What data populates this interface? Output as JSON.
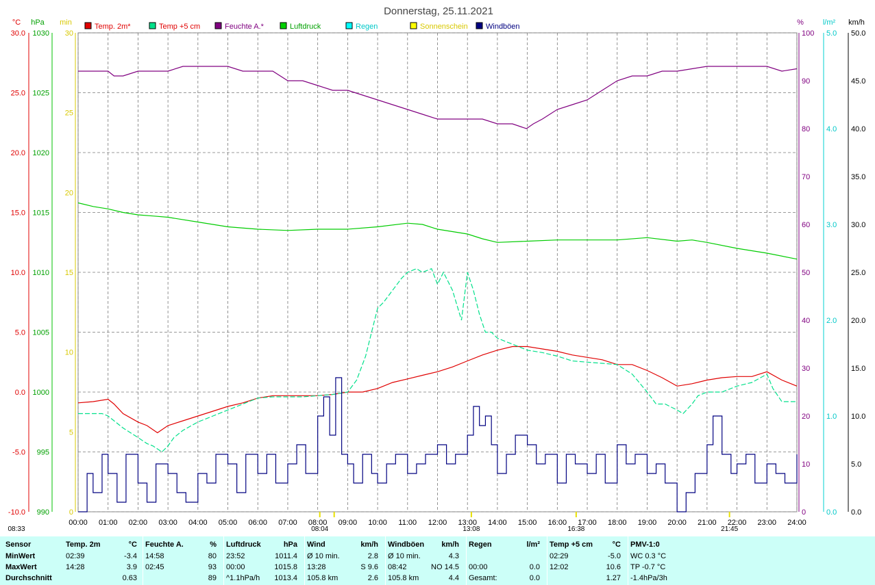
{
  "title": "Donnerstag, 25.11.2021",
  "legend": [
    {
      "label": "Temp. 2m*",
      "color": "#e00000",
      "text_color": "#e00000"
    },
    {
      "label": "Temp +5 cm",
      "color": "#00e08a",
      "text_color": "#e00000"
    },
    {
      "label": "Feuchte A.*",
      "color": "#800080",
      "text_color": "#800080"
    },
    {
      "label": "Luftdruck",
      "color": "#00d000",
      "text_color": "#00a000"
    },
    {
      "label": "Regen",
      "color": "#00ffff",
      "text_color": "#00c8c8"
    },
    {
      "label": "Sonnenschein",
      "color": "#ffff00",
      "text_color": "#d8c800"
    },
    {
      "label": "Windböen",
      "color": "#000080",
      "text_color": "#000080"
    }
  ],
  "colors": {
    "temp": "#e00000",
    "temp5": "#00e08a",
    "hum": "#800080",
    "press": "#00cc00",
    "rain": "#00d0d0",
    "sun": "#e8e000",
    "wind": "#000080",
    "grid": "#888888"
  },
  "chart_data": {
    "type": "line",
    "x_ticks": [
      "00:00",
      "01:00",
      "02:00",
      "03:00",
      "04:00",
      "05:00",
      "06:00",
      "07:00",
      "08:00",
      "09:00",
      "10:00",
      "11:00",
      "12:00",
      "13:00",
      "14:00",
      "15:00",
      "16:00",
      "17:00",
      "18:00",
      "19:00",
      "20:00",
      "21:00",
      "22:00",
      "23:00",
      "24:00"
    ],
    "xlim": [
      0,
      24
    ],
    "axes": {
      "temp": {
        "unit": "°C",
        "ticks": [
          "30.0",
          "25.0",
          "20.0",
          "15.0",
          "10.0",
          "5.0",
          "0.0",
          "-5.0",
          "-10.0"
        ],
        "ylim": [
          -10,
          30
        ]
      },
      "press": {
        "unit": "hPa",
        "ticks": [
          "1030",
          "1025",
          "1020",
          "1015",
          "1010",
          "1005",
          "1000",
          "995",
          "990"
        ],
        "ylim": [
          990,
          1030
        ]
      },
      "sun": {
        "unit": "min",
        "ticks": [
          "30",
          "25",
          "20",
          "15",
          "10",
          "5",
          "0"
        ],
        "ylim": [
          0,
          30
        ]
      },
      "hum": {
        "unit": "%",
        "ticks": [
          "100",
          "90",
          "80",
          "70",
          "60",
          "50",
          "40",
          "30",
          "20",
          "10",
          "0"
        ],
        "ylim": [
          0,
          100
        ]
      },
      "rain": {
        "unit": "l/m²",
        "ticks": [
          "5.0",
          "4.0",
          "3.0",
          "2.0",
          "1.0",
          "0.0"
        ],
        "ylim": [
          0,
          5
        ]
      },
      "wind": {
        "unit": "km/h",
        "ticks": [
          "50.0",
          "45.0",
          "40.0",
          "35.0",
          "30.0",
          "25.0",
          "20.0",
          "15.0",
          "10.0",
          "5.0",
          "0.0"
        ],
        "ylim": [
          0,
          50
        ]
      }
    },
    "series": [
      {
        "name": "Temp. 2m*",
        "axis": "temp",
        "x": [
          0,
          0.5,
          1,
          1.2,
          1.5,
          2,
          2.3,
          2.65,
          3,
          3.5,
          4,
          4.5,
          5,
          5.5,
          6,
          6.5,
          7,
          7.5,
          8,
          8.5,
          9,
          9.5,
          10,
          10.5,
          11,
          11.5,
          12,
          12.5,
          13,
          13.5,
          14,
          14.5,
          15,
          15.5,
          16,
          16.5,
          17,
          17.5,
          18,
          18.5,
          19,
          19.5,
          20,
          20.5,
          21,
          21.5,
          22,
          22.5,
          23,
          23.5,
          24
        ],
        "y": [
          -0.9,
          -0.8,
          -0.6,
          -1.0,
          -1.8,
          -2.5,
          -2.8,
          -3.4,
          -2.8,
          -2.4,
          -2.0,
          -1.6,
          -1.2,
          -0.9,
          -0.5,
          -0.3,
          -0.3,
          -0.3,
          -0.3,
          -0.2,
          0.0,
          0.0,
          0.3,
          0.8,
          1.1,
          1.4,
          1.7,
          2.1,
          2.6,
          3.1,
          3.5,
          3.8,
          3.8,
          3.6,
          3.4,
          3.1,
          2.9,
          2.7,
          2.3,
          2.3,
          1.8,
          1.2,
          0.5,
          0.7,
          1.0,
          1.2,
          1.3,
          1.3,
          1.7,
          1.0,
          0.5
        ]
      },
      {
        "name": "Feuchte A.*",
        "axis": "hum",
        "x": [
          0,
          1,
          1.2,
          1.5,
          2,
          3,
          3.5,
          4,
          4.5,
          5,
          5.5,
          6,
          6.5,
          7,
          7.5,
          8,
          8.5,
          9,
          9.5,
          10,
          10.5,
          11,
          11.5,
          12,
          12.5,
          13,
          13.5,
          14,
          14.5,
          14.97,
          15.2,
          15.5,
          16,
          16.5,
          17,
          17.5,
          18,
          18.5,
          19,
          19.5,
          20,
          20.5,
          21,
          21.5,
          22,
          22.5,
          23,
          23.5,
          24
        ],
        "y": [
          92,
          92,
          91,
          91,
          92,
          92,
          93,
          93,
          93,
          93,
          92,
          92,
          92,
          90,
          90,
          89,
          88,
          88,
          87,
          86,
          85,
          84,
          83,
          82,
          82,
          82,
          82,
          81,
          81,
          80,
          81,
          82,
          84,
          85,
          86,
          88,
          90,
          91,
          91,
          92,
          92,
          92.5,
          93,
          93,
          93,
          93,
          93,
          92,
          92.5
        ]
      },
      {
        "name": "Luftdruck",
        "axis": "press",
        "x": [
          0,
          0.5,
          1,
          1.5,
          2,
          2.5,
          3,
          4,
          5,
          6,
          7,
          8,
          9,
          10,
          11,
          11.5,
          12,
          13,
          13.5,
          14,
          15,
          16,
          17,
          18,
          19,
          20,
          20.5,
          21,
          22,
          23,
          24
        ],
        "y": [
          1015.8,
          1015.5,
          1015.3,
          1015.0,
          1014.8,
          1014.7,
          1014.6,
          1014.2,
          1013.8,
          1013.6,
          1013.5,
          1013.6,
          1013.6,
          1013.8,
          1014.1,
          1014.0,
          1013.6,
          1013.2,
          1012.8,
          1012.5,
          1012.6,
          1012.7,
          1012.7,
          1012.7,
          1012.9,
          1012.6,
          1012.7,
          1012.5,
          1012.0,
          1011.6,
          1011.1
        ]
      },
      {
        "name": "Temp +5 cm",
        "axis": "temp",
        "x": [
          0,
          0.8,
          1,
          1.5,
          2,
          2.3,
          2.5,
          2.8,
          3,
          3.2,
          3.5,
          4,
          4.5,
          5,
          5.5,
          6,
          6.5,
          7,
          7.5,
          8,
          8.5,
          9,
          9.3,
          9.6,
          9.8,
          10,
          10.2,
          10.5,
          10.8,
          11,
          11.3,
          11.5,
          11.8,
          12,
          12.2,
          12.5,
          12.8,
          13,
          13.2,
          13.4,
          13.6,
          13.8,
          14,
          14.5,
          15,
          15.5,
          16,
          16.5,
          17,
          17.5,
          18,
          18.5,
          19,
          19.3,
          19.6,
          20,
          20.2,
          20.5,
          20.7,
          21,
          21.5,
          22,
          22.5,
          23,
          23.2,
          23.5,
          24
        ],
        "y": [
          -1.8,
          -1.8,
          -2.0,
          -3.0,
          -3.8,
          -4.3,
          -4.5,
          -5.0,
          -4.5,
          -3.8,
          -3.2,
          -2.5,
          -2.0,
          -1.5,
          -1.0,
          -0.5,
          -0.4,
          -0.4,
          -0.4,
          -0.3,
          -0.2,
          0.0,
          1.0,
          3.0,
          5.0,
          7.0,
          7.5,
          8.5,
          9.5,
          10.0,
          10.3,
          10.0,
          10.3,
          9.0,
          10.0,
          8.5,
          6.0,
          10.0,
          8.5,
          6.5,
          5.0,
          5.0,
          4.5,
          4.0,
          3.5,
          3.3,
          3.0,
          2.6,
          2.5,
          2.4,
          2.3,
          1.5,
          0.0,
          -1.0,
          -1.0,
          -1.5,
          -1.8,
          -1.0,
          -0.3,
          0.0,
          0.0,
          0.5,
          0.8,
          1.5,
          0.3,
          -0.8,
          -0.8
        ]
      },
      {
        "name": "Windböen",
        "axis": "wind",
        "x": [
          0,
          0.3,
          0.5,
          0.8,
          1,
          1.3,
          1.6,
          2,
          2.3,
          2.6,
          3,
          3.3,
          3.6,
          4,
          4.3,
          4.6,
          5,
          5.3,
          5.6,
          6,
          6.3,
          6.6,
          7,
          7.3,
          7.6,
          8,
          8.2,
          8.4,
          8.6,
          8.8,
          9,
          9.2,
          9.5,
          9.8,
          10,
          10.3,
          10.6,
          11,
          11.3,
          11.6,
          12,
          12.3,
          12.6,
          13,
          13.2,
          13.4,
          13.6,
          13.8,
          14,
          14.3,
          14.6,
          15,
          15.3,
          15.6,
          16,
          16.3,
          16.6,
          17,
          17.3,
          17.6,
          18,
          18.3,
          18.6,
          19,
          19.3,
          19.6,
          20,
          20.3,
          20.6,
          21,
          21.2,
          21.5,
          21.8,
          22,
          22.3,
          22.6,
          23,
          23.3,
          23.6,
          24
        ],
        "y": [
          0,
          4,
          2,
          6,
          4,
          1,
          6,
          3,
          1,
          5,
          4,
          2,
          1,
          4,
          3,
          6,
          5,
          2,
          6,
          4,
          6,
          3,
          5,
          7,
          4,
          10,
          12,
          8,
          14,
          6,
          5,
          3,
          6,
          4,
          3,
          5,
          6,
          4,
          5,
          6,
          7,
          5,
          6,
          8,
          11,
          9,
          10,
          7,
          4,
          6,
          8,
          7,
          5,
          6,
          3,
          6,
          5,
          4,
          6,
          3,
          7,
          5,
          6,
          4,
          5,
          3,
          0,
          2,
          4,
          7,
          10,
          6,
          4,
          5,
          6,
          3,
          5,
          4,
          3,
          6
        ]
      }
    ],
    "sun_markers": [
      {
        "label": "08:33",
        "x": 8.55
      },
      {
        "label": "08:04",
        "x": 8.07
      },
      {
        "label": "13:08",
        "x": 13.13
      },
      {
        "label": "16:38",
        "x": 16.63
      },
      {
        "label": "21:45",
        "x": 21.75
      }
    ]
  },
  "table": {
    "headers": [
      "Sensor",
      "Temp. 2m",
      "°C",
      "Feuchte A.",
      "%",
      "Luftdruck",
      "hPa",
      "Wind",
      "km/h",
      "Windböen",
      "km/h",
      "Regen",
      "l/m²",
      "Temp +5 cm",
      "°C",
      "PMV-1:0"
    ],
    "rows": [
      {
        "label": "MinWert",
        "c": [
          "02:39",
          "-3.4",
          "14:58",
          "80",
          "23:52",
          "1011.4",
          "Ø 10 min.",
          "2.8",
          "Ø 10 min.",
          "4.3",
          "",
          "",
          "02:29",
          "-5.0",
          "WC 0.3 °C"
        ]
      },
      {
        "label": "MaxWert",
        "c": [
          "14:28",
          "3.9",
          "02:45",
          "93",
          "00:00",
          "1015.8",
          "13:28",
          "S 9.6",
          "08:42",
          "NO 14.5",
          "00:00",
          "0.0",
          "12:02",
          "10.6",
          "TP -0.7 °C"
        ]
      },
      {
        "label": "Durchschnitt",
        "c": [
          "",
          "0.63",
          "",
          "89",
          "^1.1hPa/h",
          "1013.4",
          "105.8 km",
          "2.6",
          "105.8 km",
          "4.4",
          "Gesamt:",
          "0.0",
          "",
          "1.27",
          "-1.4hPa/3h"
        ]
      }
    ]
  }
}
